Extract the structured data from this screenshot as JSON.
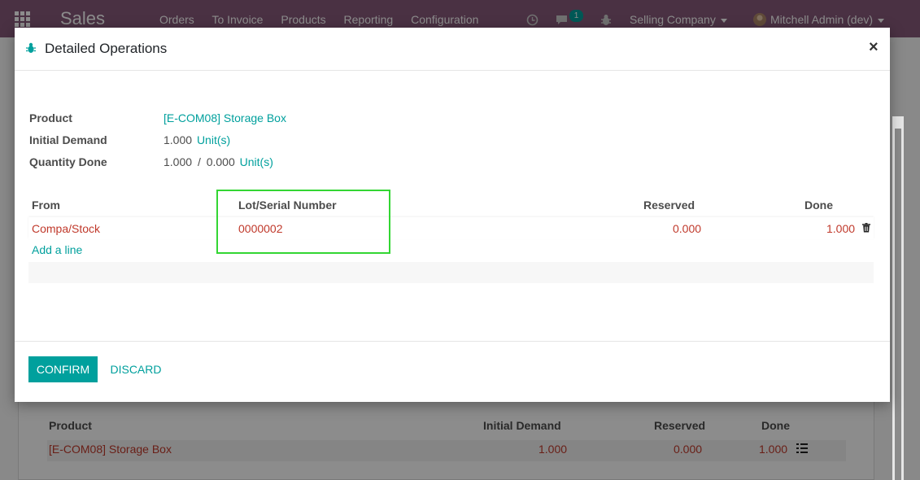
{
  "navbar": {
    "app_name": "Sales",
    "menu": [
      "Orders",
      "To Invoice",
      "Products",
      "Reporting",
      "Configuration"
    ],
    "messages_count": "1",
    "company": "Selling Company",
    "user": "Mitchell Admin (dev)"
  },
  "background_table": {
    "headers": {
      "product": "Product",
      "initial_demand": "Initial Demand",
      "reserved": "Reserved",
      "done": "Done"
    },
    "row": {
      "product": "[E-COM08] Storage Box",
      "initial_demand": "1.000",
      "reserved": "0.000",
      "done": "1.000"
    }
  },
  "modal": {
    "title": "Detailed Operations",
    "close_label": "×",
    "fields": {
      "product_label": "Product",
      "product_value": "[E-COM08] Storage Box",
      "initial_demand_label": "Initial Demand",
      "initial_demand_value": "1.000",
      "initial_demand_uom": "Unit(s)",
      "quantity_done_label": "Quantity Done",
      "quantity_done_value": "1.000",
      "quantity_done_sep": "/",
      "quantity_done_total": "0.000",
      "quantity_done_uom": "Unit(s)"
    },
    "table": {
      "headers": {
        "from": "From",
        "lot": "Lot/Serial Number",
        "reserved": "Reserved",
        "done": "Done"
      },
      "rows": [
        {
          "from": "Compa/Stock",
          "lot": "0000002",
          "reserved": "0.000",
          "done": "1.000"
        }
      ],
      "add_line": "Add a line"
    },
    "buttons": {
      "confirm": "Confirm",
      "discard": "Discard"
    }
  },
  "colors": {
    "brand": "#875a7b",
    "accent": "#00a09d",
    "highlight": "#33d633",
    "danger": "#c0392b"
  }
}
